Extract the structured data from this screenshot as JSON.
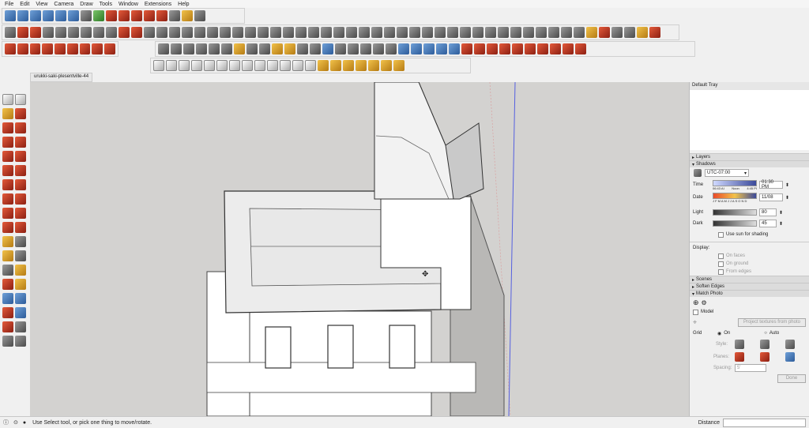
{
  "menu": [
    "File",
    "Edit",
    "View",
    "Camera",
    "Draw",
    "Tools",
    "Window",
    "Extensions",
    "Help"
  ],
  "document_tab": "urukki-saki-plesentville-44",
  "tray": {
    "title": "Default Tray",
    "sections": {
      "layers": "Layers",
      "shadows": "Shadows",
      "scenes": "Scenes",
      "soften": "Soften Edges",
      "match_photo": "Match Photo"
    },
    "shadows": {
      "timezone": "UTC-07:00",
      "time_label": "Time",
      "time_start": "06:43 AI",
      "time_noon": "Noon",
      "time_end": "4:45 PI",
      "time_value": "01:30 PM",
      "date_label": "Date",
      "months": "J F M A M J J A S O N D",
      "date_value": "11/08",
      "light_label": "Light",
      "light_value": "80",
      "dark_label": "Dark",
      "dark_value": "45",
      "use_sun": "Use sun for shading",
      "display_label": "Display:",
      "on_faces": "On faces",
      "on_ground": "On ground",
      "from_edges": "From edges"
    },
    "match_photo": {
      "model": "Model",
      "project_btn": "Project textures from photo",
      "grid_label": "Grid",
      "grid_on": "On",
      "grid_auto": "Auto",
      "style_label": "Style:",
      "planes_label": "Planes:",
      "spacing_label": "Spacing:",
      "spacing_value": "5'",
      "done": "Done"
    }
  },
  "status": {
    "message": "Use Select tool, or pick one thing to move/rotate.",
    "measure_label": "Distance"
  }
}
